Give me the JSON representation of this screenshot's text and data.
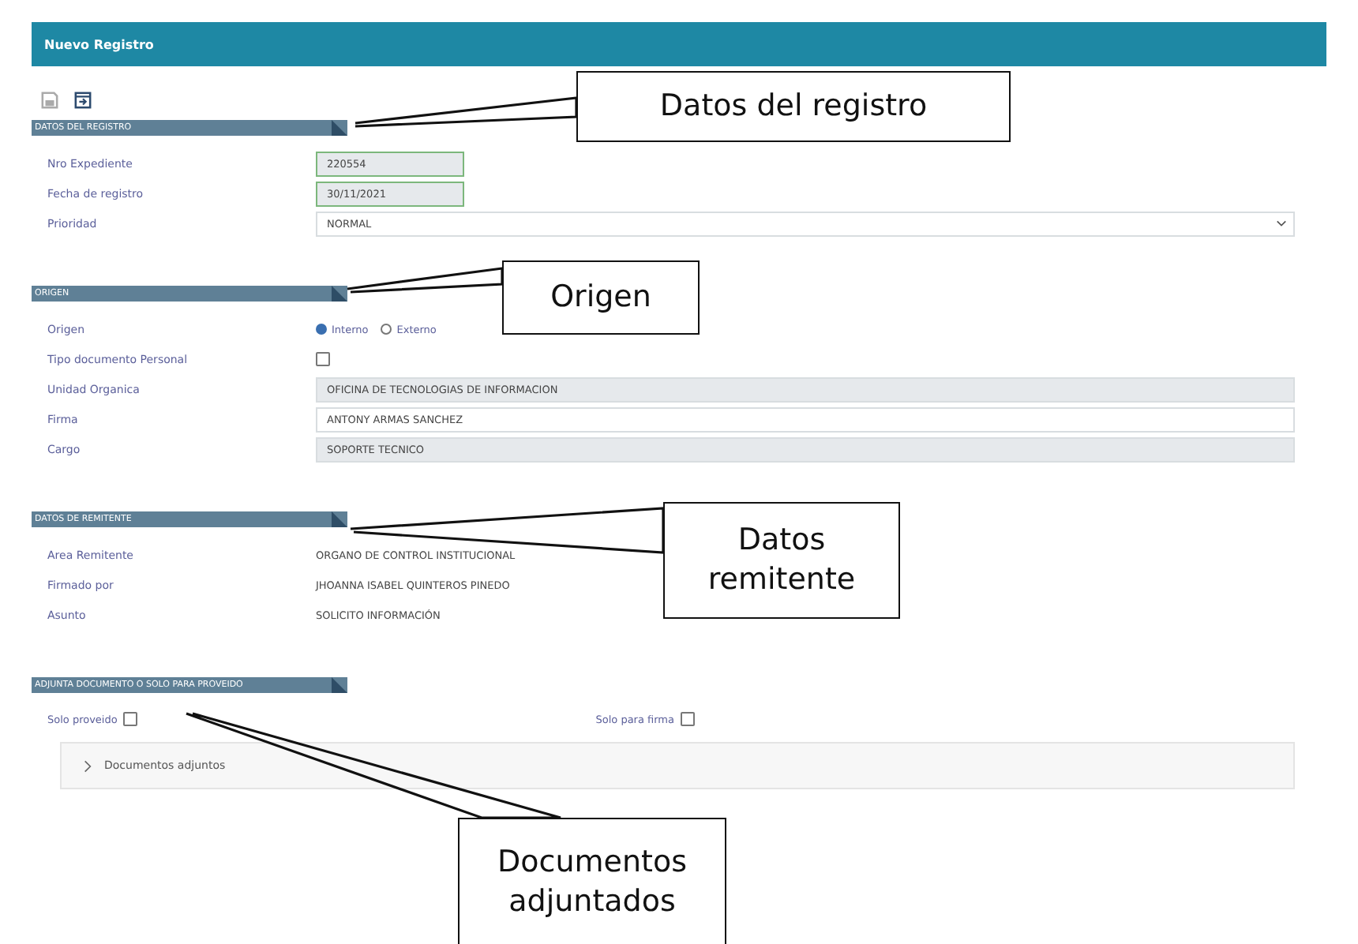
{
  "header": {
    "title": "Nuevo Registro"
  },
  "toolbar": [
    {
      "kind": "save",
      "disabled": true
    },
    {
      "kind": "export",
      "disabled": false
    }
  ],
  "sections": [
    {
      "title": "DATOS DEL REGISTRO",
      "rows": [
        {
          "kind": "short_input",
          "label": "Nro Expediente",
          "value": "220554",
          "disabled": true
        },
        {
          "kind": "short_input",
          "label": "Fecha de registro",
          "value": "30/11/2021",
          "disabled": true
        },
        {
          "kind": "select",
          "label": "Prioridad",
          "value": "NORMAL"
        }
      ]
    },
    {
      "title": "ORIGEN",
      "rows": [
        {
          "kind": "radio",
          "label": "Origen",
          "options": [
            {
              "label": "Interno",
              "selected": true
            },
            {
              "label": "Externo",
              "selected": false
            }
          ]
        },
        {
          "kind": "checkbox",
          "label": "Tipo documento Personal",
          "checked": false
        },
        {
          "kind": "input",
          "label": "Unidad Organica",
          "value": "OFICINA DE TECNOLOGIAS DE INFORMACION",
          "disabled": true
        },
        {
          "kind": "input",
          "label": "Firma",
          "value": "ANTONY ARMAS SANCHEZ",
          "disabled": false
        },
        {
          "kind": "input",
          "label": "Cargo",
          "value": "SOPORTE TECNICO",
          "disabled": true
        }
      ]
    },
    {
      "title": "DATOS DE REMITENTE",
      "rows": [
        {
          "kind": "text",
          "label": "Area Remitente",
          "value": "ORGANO DE CONTROL INSTITUCIONAL"
        },
        {
          "kind": "text",
          "label": "Firmado por",
          "value": "JHOANNA ISABEL QUINTEROS PINEDO"
        },
        {
          "kind": "text",
          "label": "Asunto",
          "value": "SOLICITO INFORMACIÓN"
        }
      ]
    },
    {
      "title": "ADJUNTA DOCUMENTO O SOLO PARA PROVEIDO",
      "checks": [
        {
          "label": "Solo proveido",
          "checked": false
        },
        {
          "label": "Solo para firma",
          "checked": false
        }
      ],
      "accordion": {
        "label": "Documentos adjuntos",
        "expanded": false
      }
    }
  ],
  "callouts": [
    {
      "text": "Datos del registro"
    },
    {
      "text": "Origen"
    },
    {
      "text": "Datos remitente"
    },
    {
      "text": "Documentos adjuntados"
    }
  ]
}
